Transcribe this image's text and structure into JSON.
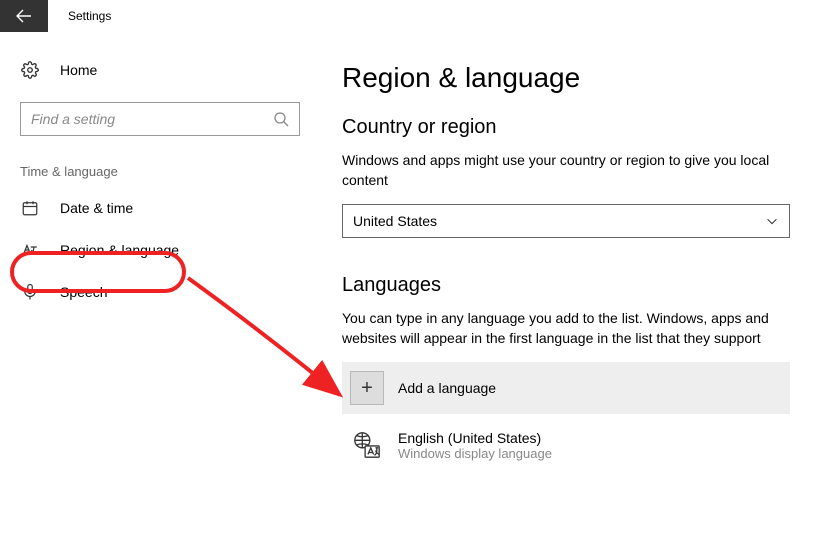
{
  "titlebar": {
    "title": "Settings"
  },
  "sidebar": {
    "home_label": "Home",
    "search_placeholder": "Find a setting",
    "section_label": "Time & language",
    "items": [
      {
        "label": "Date & time"
      },
      {
        "label": "Region & language"
      },
      {
        "label": "Speech"
      }
    ]
  },
  "main": {
    "heading": "Region & language",
    "country_heading": "Country or region",
    "country_desc": "Windows and apps might use your country or region to give you local content",
    "country_value": "United States",
    "languages_heading": "Languages",
    "languages_desc": "You can type in any language you add to the list. Windows, apps and websites will appear in the first language in the list that they support",
    "add_language_label": "Add a language",
    "languages": [
      {
        "name": "English (United States)",
        "sub": "Windows display language"
      }
    ]
  }
}
